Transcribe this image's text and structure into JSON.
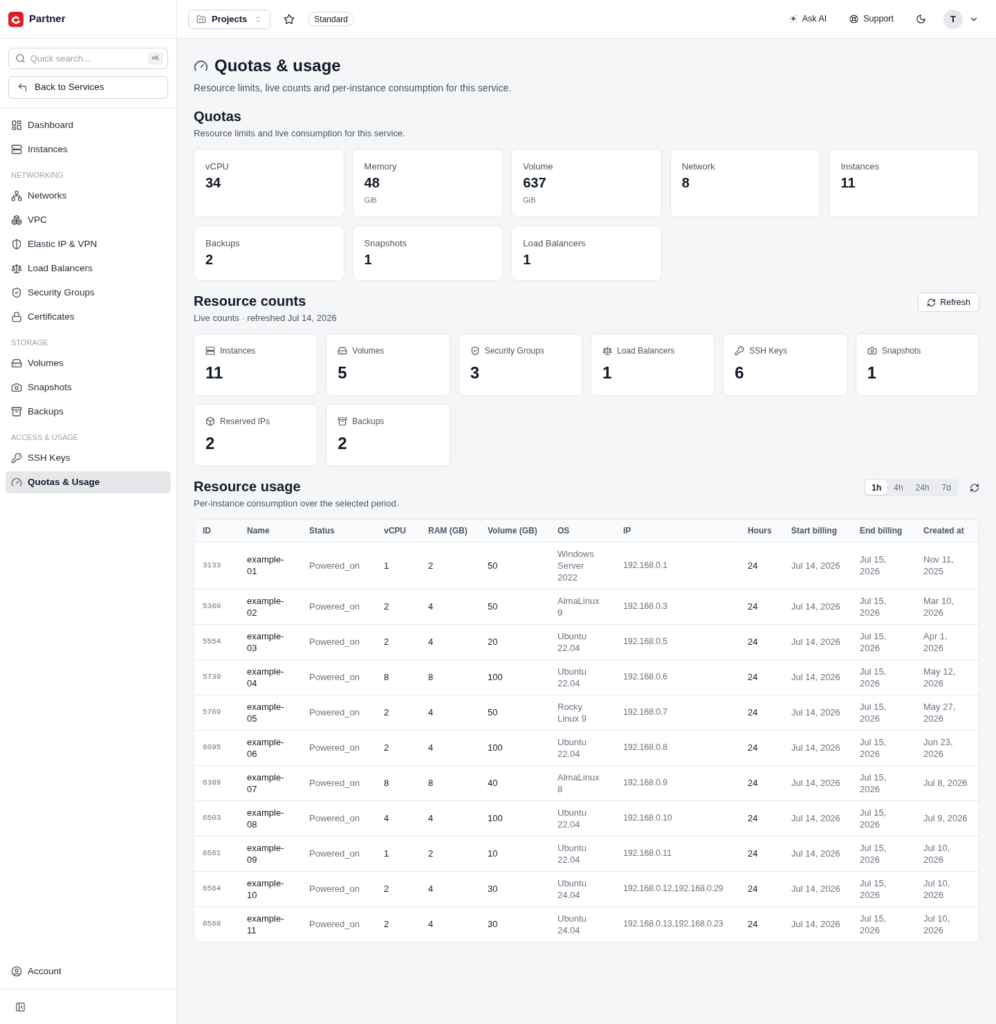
{
  "sidebar": {
    "brand": "Partner",
    "search": {
      "placeholder": "Quick search...",
      "shortcut": "⌘K"
    },
    "back_button": "Back to Services",
    "sections": [
      {
        "items": [
          {
            "label": "Dashboard",
            "selected": false
          },
          {
            "label": "Instances",
            "selected": false
          }
        ]
      },
      {
        "heading": "NETWORKING",
        "items": [
          {
            "label": "Networks",
            "selected": false
          },
          {
            "label": "VPC",
            "selected": false
          },
          {
            "label": "Elastic IP & VPN",
            "selected": false
          },
          {
            "label": "Load Balancers",
            "selected": false
          },
          {
            "label": "Security Groups",
            "selected": false
          },
          {
            "label": "Certificates",
            "selected": false
          }
        ]
      },
      {
        "heading": "STORAGE",
        "items": [
          {
            "label": "Volumes",
            "selected": false
          },
          {
            "label": "Snapshots",
            "selected": false
          },
          {
            "label": "Backups",
            "selected": false
          }
        ]
      },
      {
        "heading": "ACCESS & USAGE",
        "items": [
          {
            "label": "SSH Keys",
            "selected": false
          },
          {
            "label": "Quotas & Usage",
            "selected": true
          }
        ]
      }
    ],
    "account": "Account"
  },
  "topbar": {
    "project_button": "Projects",
    "plan_badge": "Standard",
    "ask_ai_button": "Ask AI",
    "support_button": "Support",
    "avatar_initial": "T"
  },
  "page": {
    "title": "Quotas & usage",
    "description": "Resource limits, live counts and per-instance consumption for this service."
  },
  "quotas": {
    "title": "Quotas",
    "description": "Resource limits and live consumption for this service.",
    "cards": [
      {
        "label": "vCPU",
        "value": "34"
      },
      {
        "label": "Memory",
        "value": "48",
        "unit": "GiB"
      },
      {
        "label": "Volume",
        "value": "637",
        "unit": "GiB"
      },
      {
        "label": "Network",
        "value": "8"
      },
      {
        "label": "Instances",
        "value": "11"
      },
      {
        "label": "Backups",
        "value": "2"
      },
      {
        "label": "Snapshots",
        "value": "1"
      },
      {
        "label": "Load Balancers",
        "value": "1"
      }
    ]
  },
  "resource_counts": {
    "title": "Resource counts",
    "description": "Live counts · refreshed Jul 14, 2026",
    "refresh_button": "Refresh",
    "cards": [
      {
        "label": "Instances",
        "value": "11"
      },
      {
        "label": "Volumes",
        "value": "5"
      },
      {
        "label": "Security Groups",
        "value": "3"
      },
      {
        "label": "Load Balancers",
        "value": "1"
      },
      {
        "label": "SSH Keys",
        "value": "6"
      },
      {
        "label": "Snapshots",
        "value": "1"
      },
      {
        "label": "Reserved IPs",
        "value": "2"
      },
      {
        "label": "Backups",
        "value": "2"
      }
    ]
  },
  "resource_usage": {
    "title": "Resource usage",
    "description": "Per-instance consumption over the selected period.",
    "periods": [
      {
        "label": "1h",
        "selected": true
      },
      {
        "label": "4h",
        "selected": false
      },
      {
        "label": "24h",
        "selected": false
      },
      {
        "label": "7d",
        "selected": false
      }
    ],
    "table": {
      "columns": [
        "ID",
        "Name",
        "Status",
        "vCPU",
        "RAM (GB)",
        "Volume (GB)",
        "OS",
        "IP",
        "Hours",
        "Start billing",
        "End billing",
        "Created at"
      ],
      "rows": [
        [
          "3133",
          "example-01",
          "Powered_on",
          "1",
          "2",
          "50",
          "Windows Server 2022",
          "192.168.0.1",
          "24",
          "Jul 14, 2026",
          "Jul 15, 2026",
          "Nov 11, 2025"
        ],
        [
          "5360",
          "example-02",
          "Powered_on",
          "2",
          "4",
          "50",
          "AlmaLinux 9",
          "192.168.0.3",
          "24",
          "Jul 14, 2026",
          "Jul 15, 2026",
          "Mar 10, 2026"
        ],
        [
          "5554",
          "example-03",
          "Powered_on",
          "2",
          "4",
          "20",
          "Ubuntu 22.04",
          "192.168.0.5",
          "24",
          "Jul 14, 2026",
          "Jul 15, 2026",
          "Apr 1, 2026"
        ],
        [
          "5739",
          "example-04",
          "Powered_on",
          "8",
          "8",
          "100",
          "Ubuntu 22.04",
          "192.168.0.6",
          "24",
          "Jul 14, 2026",
          "Jul 15, 2026",
          "May 12, 2026"
        ],
        [
          "5769",
          "example-05",
          "Powered_on",
          "2",
          "4",
          "50",
          "Rocky Linux 9",
          "192.168.0.7",
          "24",
          "Jul 14, 2026",
          "Jul 15, 2026",
          "May 27, 2026"
        ],
        [
          "6095",
          "example-06",
          "Powered_on",
          "2",
          "4",
          "100",
          "Ubuntu 22.04",
          "192.168.0.8",
          "24",
          "Jul 14, 2026",
          "Jul 15, 2026",
          "Jun 23, 2026"
        ],
        [
          "6389",
          "example-07",
          "Powered_on",
          "8",
          "8",
          "40",
          "AlmaLinux 8",
          "192.168.0.9",
          "24",
          "Jul 14, 2026",
          "Jul 15, 2026",
          "Jul 8, 2026"
        ],
        [
          "6503",
          "example-08",
          "Powered_on",
          "4",
          "4",
          "100",
          "Ubuntu 22.04",
          "192.168.0.10",
          "24",
          "Jul 14, 2026",
          "Jul 15, 2026",
          "Jul 9, 2026"
        ],
        [
          "6561",
          "example-09",
          "Powered_on",
          "1",
          "2",
          "10",
          "Ubuntu 22.04",
          "192.168.0.11",
          "24",
          "Jul 14, 2026",
          "Jul 15, 2026",
          "Jul 10, 2026"
        ],
        [
          "6564",
          "example-10",
          "Powered_on",
          "2",
          "4",
          "30",
          "Ubuntu 24.04",
          "192.168.0.12,192.168.0.29",
          "24",
          "Jul 14, 2026",
          "Jul 15, 2026",
          "Jul 10, 2026"
        ],
        [
          "6568",
          "example-11",
          "Powered_on",
          "2",
          "4",
          "30",
          "Ubuntu 24.04",
          "192.168.0.13,192.168.0.23",
          "24",
          "Jul 14, 2026",
          "Jul 15, 2026",
          "Jul 10, 2026"
        ]
      ]
    }
  }
}
